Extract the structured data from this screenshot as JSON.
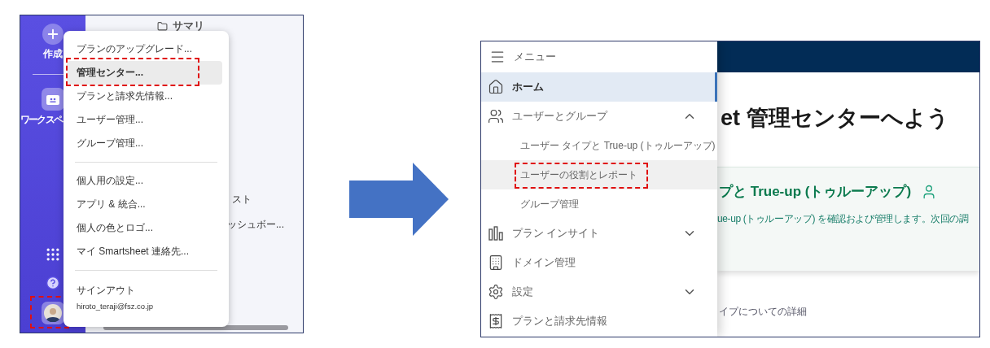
{
  "left_screen": {
    "sidebar": {
      "create_label": "作成",
      "workspace_label": "ワークスペ",
      "avatar_highlighted": true
    },
    "background": {
      "title": "サマリ",
      "texts": [
        "スト",
        "ッシュボー..."
      ]
    },
    "account_menu": {
      "groups": [
        [
          {
            "label": "プランのアップグレード...",
            "selected": false,
            "highlighted": false
          },
          {
            "label": "管理センター...",
            "selected": true,
            "highlighted": true
          },
          {
            "label": "プランと請求先情報...",
            "selected": false,
            "highlighted": false
          },
          {
            "label": "ユーザー管理...",
            "selected": false,
            "highlighted": false
          },
          {
            "label": "グループ管理...",
            "selected": false,
            "highlighted": false
          }
        ],
        [
          {
            "label": "個人用の設定...",
            "selected": false,
            "highlighted": false
          },
          {
            "label": "アプリ & 統合...",
            "selected": false,
            "highlighted": false
          },
          {
            "label": "個人の色とロゴ...",
            "selected": false,
            "highlighted": false
          },
          {
            "label": "マイ Smartsheet 連絡先...",
            "selected": false,
            "highlighted": false
          }
        ]
      ],
      "sign_out": "サインアウト",
      "email": "hiroto_teraji@fsz.co.jp"
    }
  },
  "right_screen": {
    "menu": {
      "title": "メニュー",
      "items": [
        {
          "label": "ホーム",
          "selected": true
        },
        {
          "label": "ユーザーとグループ",
          "selected": false,
          "expanded": true,
          "children": [
            {
              "label": "ユーザー タイプと True-up (トゥルーアップ)",
              "selected": false,
              "hovered": false,
              "highlighted": false
            },
            {
              "label": "ユーザーの役割とレポート",
              "selected": false,
              "hovered": true,
              "highlighted": true
            },
            {
              "label": "グループ管理",
              "selected": false,
              "hovered": false,
              "highlighted": false
            }
          ]
        },
        {
          "label": "プラン インサイト",
          "selected": false,
          "expanded": false
        },
        {
          "label": "ドメイン管理",
          "selected": false
        },
        {
          "label": "設定",
          "selected": false,
          "expanded": false
        },
        {
          "label": "プランと請求先情報",
          "selected": false
        }
      ]
    },
    "main": {
      "heading": "et 管理センターへよう",
      "card": {
        "title": "プと True-up (トゥルーアップ)",
        "text": "ue-up (トゥルーアップ) を確認および管理します。次回の調"
      },
      "link": "イプについての詳細"
    }
  }
}
